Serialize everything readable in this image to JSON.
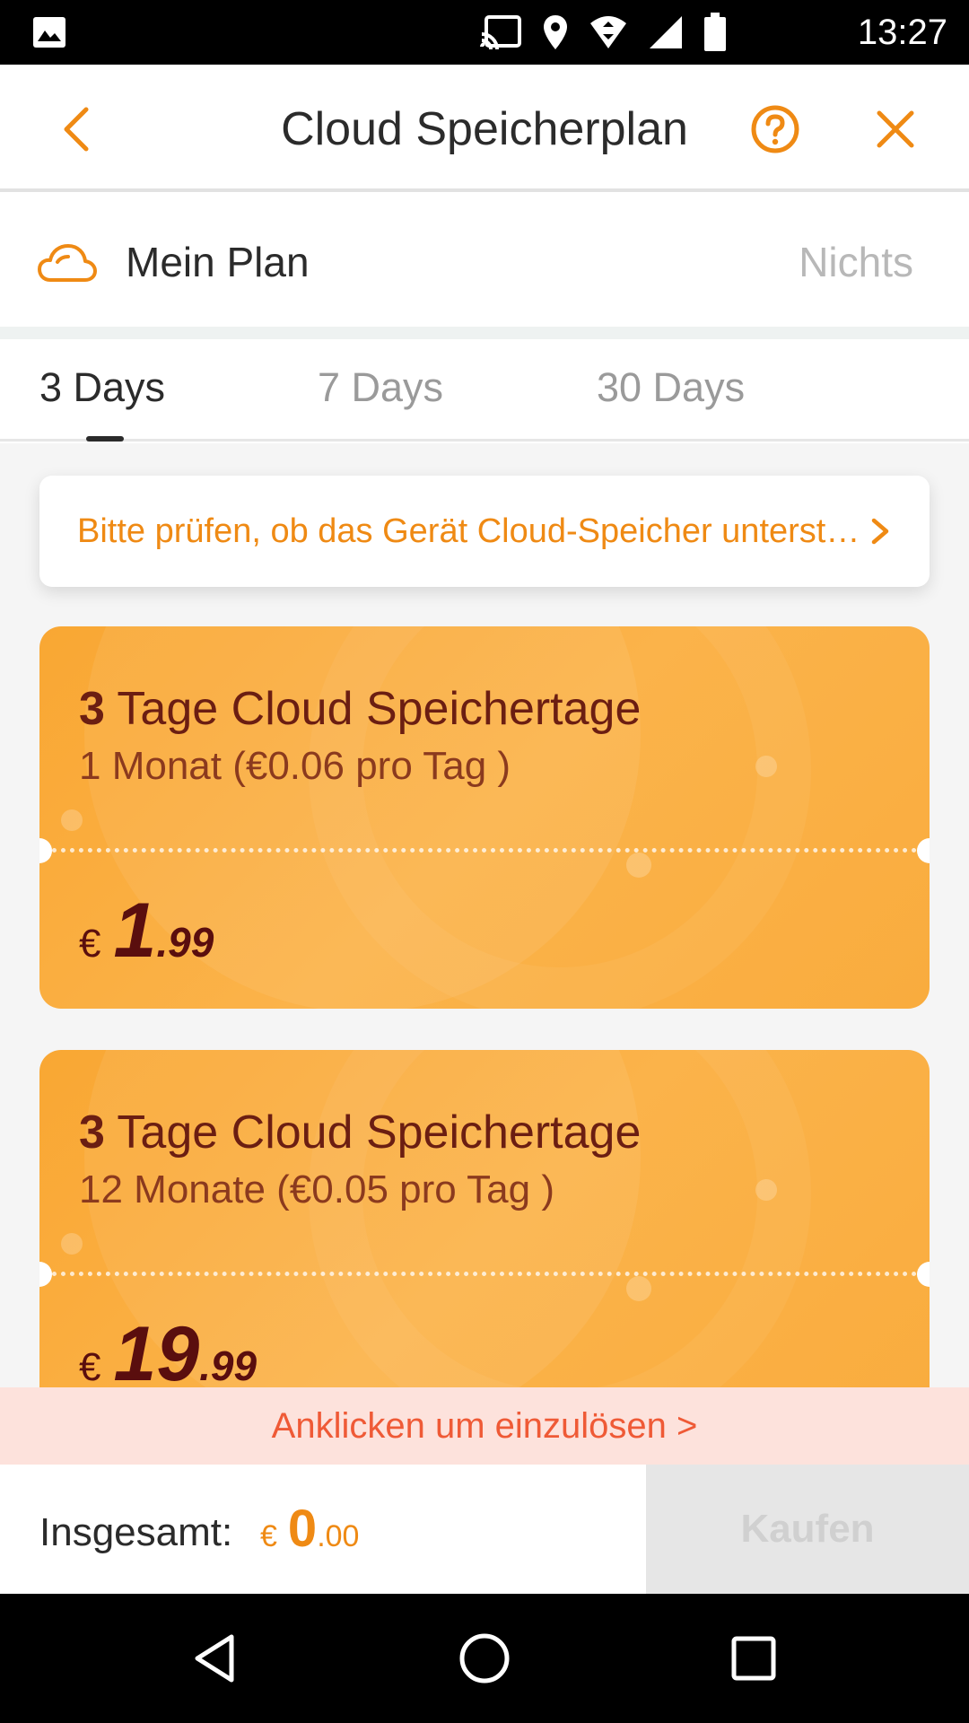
{
  "status_bar": {
    "time": "13:27",
    "icons": [
      "image-icon",
      "cast-icon",
      "location-icon",
      "wifi-icon",
      "signal-icon",
      "battery-icon"
    ]
  },
  "header": {
    "title": "Cloud Speicherplan",
    "icons": {
      "back": "chevron-left-icon",
      "help": "help-circle-icon",
      "close": "close-icon"
    }
  },
  "my_plan": {
    "label": "Mein Plan",
    "value": "Nichts",
    "icon": "cloud-icon"
  },
  "tabs": [
    {
      "label": "3 Days",
      "active": true
    },
    {
      "label": "7 Days",
      "active": false
    },
    {
      "label": "30 Days",
      "active": false
    }
  ],
  "notice": {
    "text": "Bitte prüfen, ob das Gerät Cloud-Speicher unterstützt",
    "icon": "chevron-right-icon"
  },
  "plans": [
    {
      "days_number": "3",
      "title_rest": " Tage Cloud Speichertage",
      "subtitle": "1 Monat (€0.06 pro Tag )",
      "currency": "€",
      "price_int": "1",
      "price_dec": ".99"
    },
    {
      "days_number": "3",
      "title_rest": " Tage Cloud Speichertage",
      "subtitle": "12 Monate (€0.05 pro Tag )",
      "currency": "€",
      "price_int": "19",
      "price_dec": ".99"
    }
  ],
  "redeem": {
    "text": "Anklicken um einzulösen >"
  },
  "bottom": {
    "total_label": "Insgesamt:",
    "currency": "€",
    "total_int": "0",
    "total_dec": ".00",
    "buy_label": "Kaufen"
  },
  "colors": {
    "accent": "#ef8a14",
    "card": "#f9a733",
    "card_text": "#6b1e12",
    "redeem_bg": "#fde2dc",
    "redeem_text": "#ef5a36"
  },
  "nav_bar": {
    "icons": [
      "back-triangle-icon",
      "home-circle-icon",
      "recents-square-icon"
    ]
  }
}
